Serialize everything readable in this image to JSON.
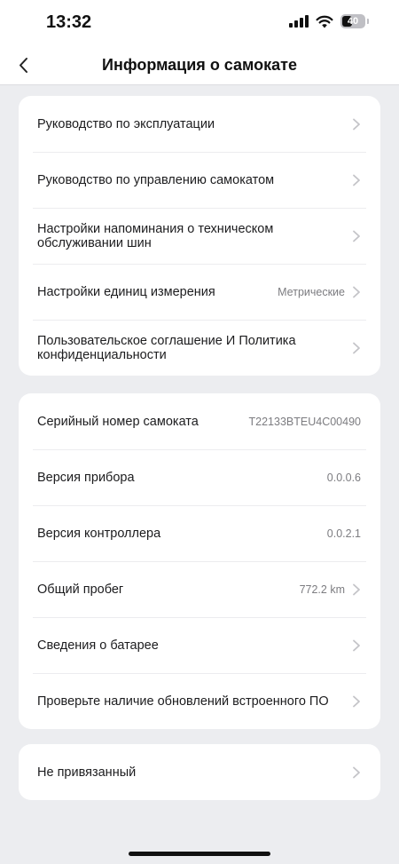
{
  "status_bar": {
    "time": "13:32",
    "battery": "40"
  },
  "header": {
    "title": "Информация о самокате",
    "back_icon": "chevron-left-icon"
  },
  "section1": {
    "items": [
      {
        "label": "Руководство по эксплуатации",
        "value": ""
      },
      {
        "label": "Руководство по управлению самокатом",
        "value": ""
      },
      {
        "label": "Настройки напоминания о техническом обслуживании шин",
        "value": ""
      },
      {
        "label": "Настройки единиц измерения",
        "value": "Метрические"
      },
      {
        "label": "Пользовательское соглашение И Политика конфиденциальности",
        "value": ""
      }
    ]
  },
  "section2": {
    "items": [
      {
        "label": "Серийный номер самоката",
        "value": "T22133BTEU4C00490"
      },
      {
        "label": "Версия прибора",
        "value": "0.0.0.6"
      },
      {
        "label": "Версия контроллера",
        "value": "0.0.2.1"
      },
      {
        "label": "Общий пробег",
        "value": "772.2 km"
      },
      {
        "label": "Сведения о батарее",
        "value": ""
      },
      {
        "label": "Проверьте наличие обновлений встроенного ПО",
        "value": ""
      }
    ]
  },
  "section3": {
    "items": [
      {
        "label": "Не привязанный",
        "value": ""
      }
    ]
  },
  "colors": {
    "background": "#ecedf0",
    "card": "#ffffff",
    "secondary_text": "#7c7c80",
    "chevron": "#c4c4c8"
  }
}
